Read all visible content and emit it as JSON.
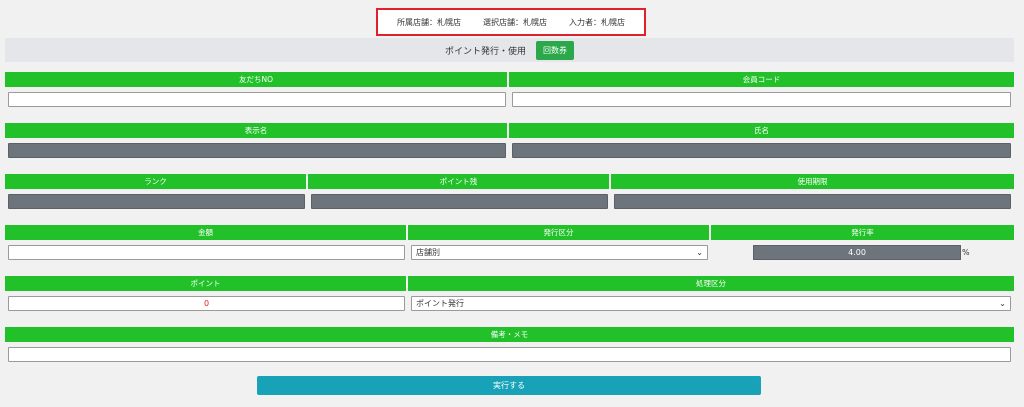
{
  "store_info": {
    "affiliated": "所属店舗：札幌店",
    "selected": "選択店舗：札幌店",
    "entered_by": "入力者：札幌店"
  },
  "title": {
    "text": "ポイント発行・使用",
    "ticket_button": "回数券"
  },
  "row1": {
    "friend_no": "友だちNO",
    "member_code": "会員コード"
  },
  "row2": {
    "display_name": "表示名",
    "full_name": "氏名"
  },
  "row3": {
    "rank": "ランク",
    "points_left": "ポイント残",
    "expiry": "使用期限"
  },
  "row4": {
    "amount": "金額",
    "issue_type": "発行区分",
    "issue_rate": "発行率",
    "issue_type_value": "店舗別",
    "rate_value": "4.00",
    "pct": "%"
  },
  "row5": {
    "points": "ポイント",
    "process_type": "処理区分",
    "points_value": "0",
    "process_value": "ポイント発行"
  },
  "row6": {
    "memo": "備考・メモ"
  },
  "execute_button": "実行する",
  "colors": {
    "green": "#22c12a",
    "teal": "#17a2b8",
    "highlight": "#e0202a"
  }
}
